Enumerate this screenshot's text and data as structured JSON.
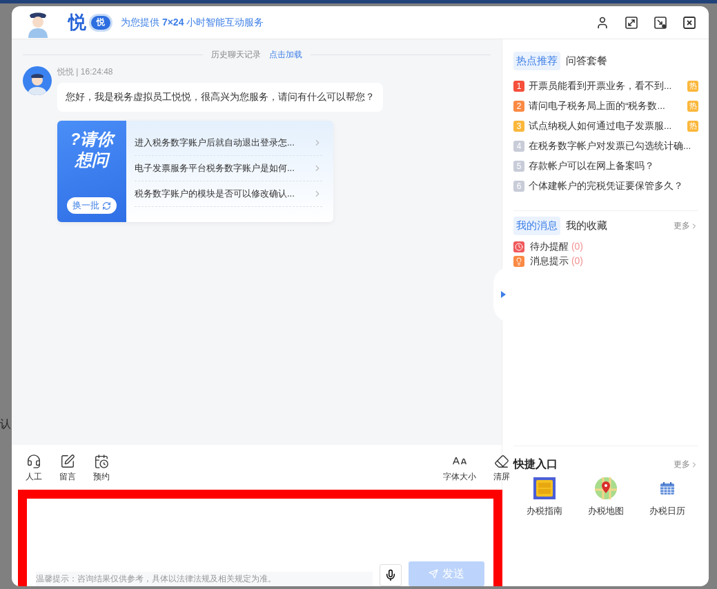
{
  "backdrop": {
    "left_fragment": "认"
  },
  "header": {
    "brand": "悦",
    "badge": "悦",
    "slogan": "为您提供 **7×24** 小时智能互动服务"
  },
  "window_controls": [
    {
      "kind": "user"
    },
    {
      "kind": "expand"
    },
    {
      "kind": "dock"
    },
    {
      "kind": "close"
    }
  ],
  "history": {
    "label": "历史聊天记录",
    "link": "点击加载"
  },
  "message": {
    "sender": "悦悦 | 16:24:48",
    "text": "您好，我是税务虚拟员工悦悦，很高兴为您服务，请问有什么可以帮您？"
  },
  "suggest": {
    "title_lines": [
      "?请你",
      "想问"
    ],
    "refresh": "换一批",
    "questions": [
      "进入税务数字账户后就自动退出登录怎...",
      "电子发票服务平台税务数字账户是如何...",
      "税务数字账户的模块是否可以修改确认..."
    ]
  },
  "toolbar": {
    "left": [
      {
        "kind": "agent",
        "label": "人工"
      },
      {
        "kind": "note",
        "label": "留言"
      },
      {
        "kind": "schedule",
        "label": "预约"
      }
    ],
    "right": [
      {
        "kind": "font",
        "label": "字体大小"
      },
      {
        "kind": "eraser",
        "label": "清屏"
      }
    ]
  },
  "input": {
    "notice": "温馨提示：咨询结果仅供参考，具体以法律法规及相关规定为准。",
    "send": "发送",
    "send_disabled": true,
    "highlighted": true
  },
  "hot": {
    "tabs": [
      {
        "label": "热点推荐",
        "selected": true
      },
      {
        "label": "问答套餐",
        "selected": false
      }
    ],
    "items": [
      {
        "rank": "1",
        "text": "开票员能看到开票业务，看不到...",
        "tag": "热",
        "color": "#f5503c"
      },
      {
        "rank": "2",
        "text": "请问电子税务局上面的“税务数...",
        "tag": "热",
        "color": "#fb8a45"
      },
      {
        "rank": "3",
        "text": "试点纳税人如何通过电子发票服...",
        "tag": "热",
        "color": "#fbb73b"
      },
      {
        "rank": "4",
        "text": "在税务数字帐户对发票已勾选统计确...",
        "color": "#c8ccd8"
      },
      {
        "rank": "5",
        "text": "存款帐户可以在网上备案吗？",
        "color": "#c8ccd8"
      },
      {
        "rank": "6",
        "text": "个体建帐户的完税凭证要保管多久？",
        "color": "#c8ccd8"
      }
    ]
  },
  "messages_panel": {
    "tabs": [
      {
        "label": "我的消息",
        "selected": true
      },
      {
        "label": "我的收藏",
        "selected": false
      }
    ],
    "more": "更多",
    "items": [
      {
        "kind": "todo",
        "label": "待办提醒",
        "count": "(0)"
      },
      {
        "kind": "notice",
        "label": "消息提示",
        "count": "(0)"
      }
    ]
  },
  "quick": {
    "title": "快捷入口",
    "more": "更多",
    "items": [
      {
        "kind": "guide",
        "label": "办税指南"
      },
      {
        "kind": "map",
        "label": "办税地图"
      },
      {
        "kind": "calendar",
        "label": "办税日历"
      }
    ]
  }
}
